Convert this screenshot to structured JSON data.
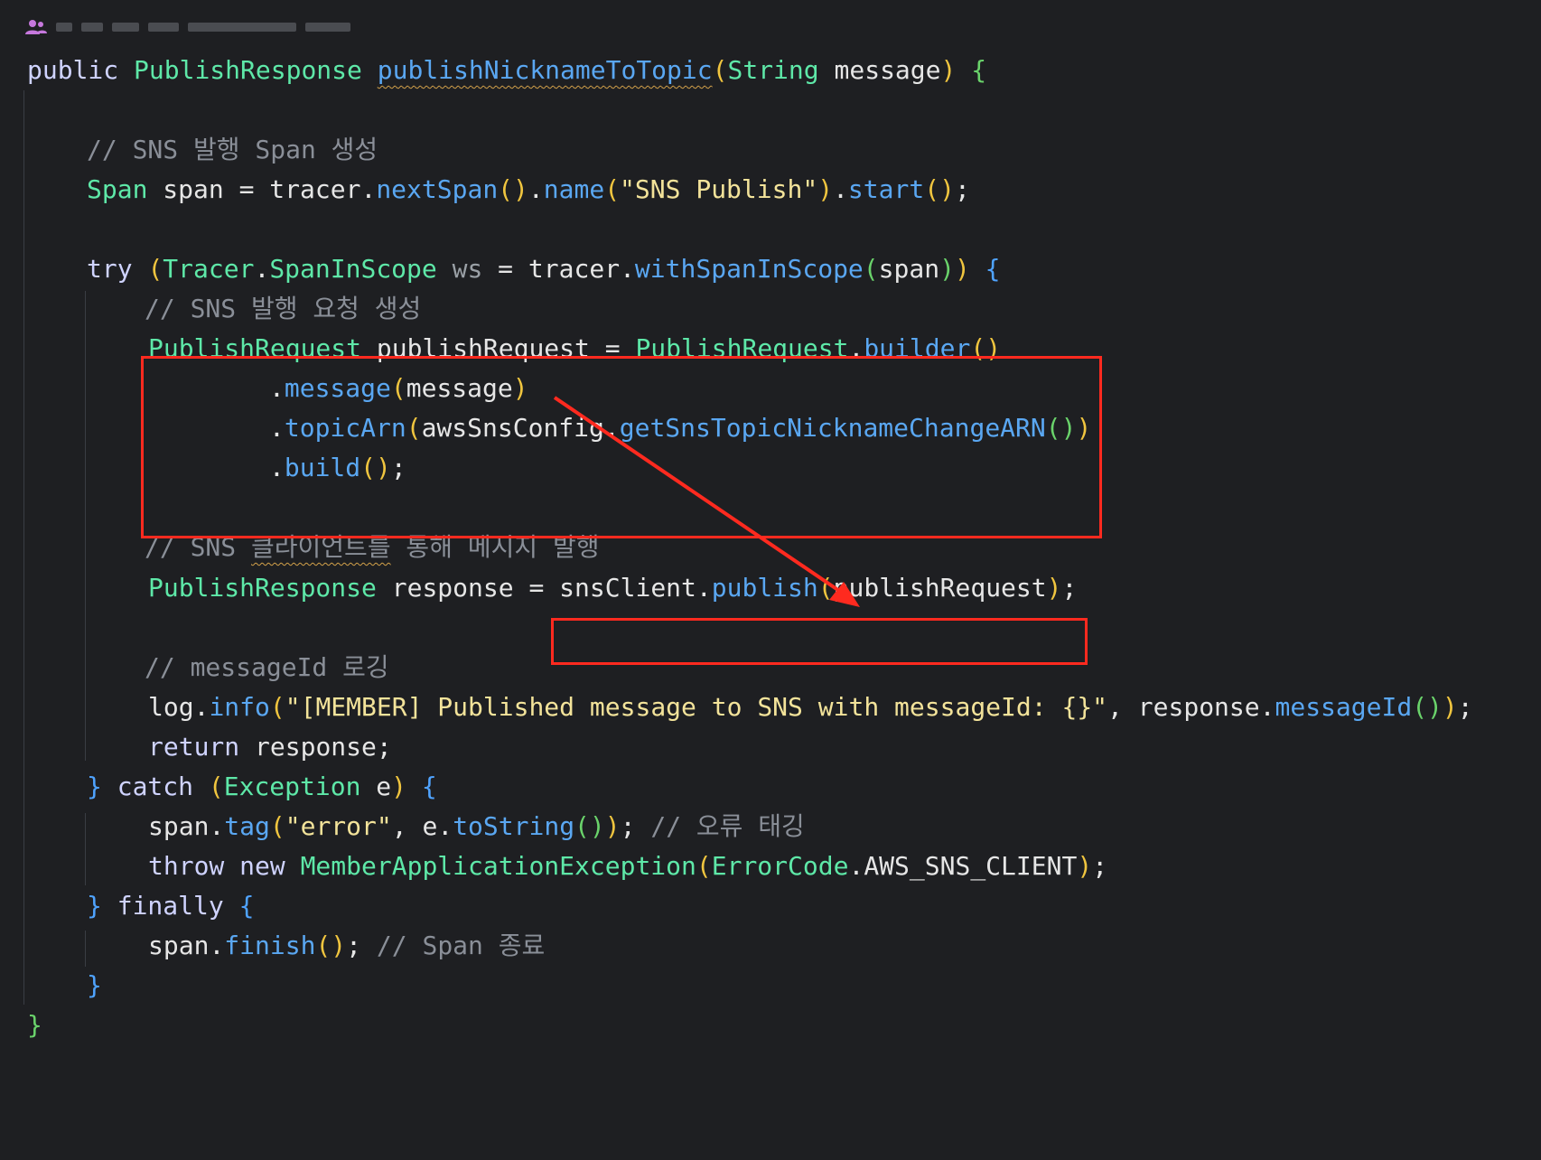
{
  "colors": {
    "background": "#1e1f22",
    "keyword": "#cfd3ff",
    "type": "#5ee8a8",
    "method": "#5aa7f2",
    "string": "#f3e39a",
    "comment": "#8a8f98",
    "annotation_box": "#ff2a1f"
  },
  "author_hint": {
    "icon": "people-icon"
  },
  "code": {
    "l1": {
      "t1": "public ",
      "t2": "PublishResponse",
      "t3": " ",
      "t4": "publishNicknameToTopic",
      "t5": "(",
      "t6": "String",
      "t7": " message",
      "t8": ")",
      "t9": " {"
    },
    "l3": {
      "t1": "// SNS 발행 Span 생성"
    },
    "l4": {
      "t1": "Span",
      "t2": " span = ",
      "t3": "tracer",
      "t4": ".",
      "t5": "nextSpan",
      "t6": "()",
      "t7": ".",
      "t8": "name",
      "t9": "(",
      "t10": "\"SNS Publish\"",
      "t11": ")",
      "t12": ".",
      "t13": "start",
      "t14": "()",
      "t15": ";"
    },
    "l6": {
      "t1": "try ",
      "t2": "(",
      "t3": "Tracer",
      "t4": ".",
      "t5": "SpanInScope",
      "t6": " ws",
      "t7": " = ",
      "t8": "tracer",
      "t9": ".",
      "t10": "withSpanInScope",
      "t11": "(",
      "t12": "span",
      "t13": ")",
      "t14": ")",
      "t15": " {"
    },
    "l7": {
      "t1": "// SNS 발행 요청 생성"
    },
    "l8": {
      "t1": "PublishRequest",
      "t2": " publishRequest = ",
      "t3": "PublishRequest",
      "t4": ".",
      "t5": "builder",
      "t6": "()"
    },
    "l9": {
      "t1": ".",
      "t2": "message",
      "t3": "(",
      "t4": "message",
      "t5": ")"
    },
    "l10": {
      "t1": ".",
      "t2": "topicArn",
      "t3": "(",
      "t4": "awsSnsConfig",
      "t5": ".",
      "t6": "getSnsTopicNicknameChangeARN",
      "t7": "()",
      "t8": ")"
    },
    "l11": {
      "t1": ".",
      "t2": "build",
      "t3": "()",
      "t4": ";"
    },
    "l13": {
      "t1": "// SNS ",
      "t2": "클라이언트를",
      "t3": " 통해 메시지 발행"
    },
    "l14": {
      "t1": "PublishResponse",
      "t2": " response = ",
      "t3": "snsClient",
      "t4": ".",
      "t5": "publish",
      "t6": "(",
      "t7": "publishRequest",
      "t8": ")",
      "t9": ";"
    },
    "l16": {
      "t1": "// messageId 로깅"
    },
    "l17": {
      "t1": "log",
      "t2": ".",
      "t3": "info",
      "t4": "(",
      "t5": "\"[MEMBER] Published message to SNS with messageId: {}\"",
      "t6": ", ",
      "t7": "response",
      "t8": ".",
      "t9": "messageId",
      "t10": "()",
      "t11": ")",
      "t12": ";"
    },
    "l18": {
      "t1": "return",
      "t2": " response;"
    },
    "l19": {
      "t1": "}",
      "t2": " catch ",
      "t3": "(",
      "t4": "Exception",
      "t5": " e",
      "t6": ")",
      "t7": " {"
    },
    "l20": {
      "t1": "span",
      "t2": ".",
      "t3": "tag",
      "t4": "(",
      "t5": "\"error\"",
      "t6": ", ",
      "t7": "e",
      "t8": ".",
      "t9": "toString",
      "t10": "()",
      "t11": ")",
      "t12": ";",
      "t13": " // 오류 태깅"
    },
    "l21": {
      "t1": "throw new ",
      "t2": "MemberApplicationException",
      "t3": "(",
      "t4": "ErrorCode",
      "t5": ".",
      "t6": "AWS_SNS_CLIENT",
      "t7": ")",
      "t8": ";"
    },
    "l22": {
      "t1": "}",
      "t2": " finally ",
      "t3": "{"
    },
    "l23": {
      "t1": "span",
      "t2": ".",
      "t3": "finish",
      "t4": "()",
      "t5": ";",
      "t6": " // Span 종료"
    },
    "l24": {
      "t1": "}"
    },
    "l25": {
      "t1": "}"
    }
  }
}
